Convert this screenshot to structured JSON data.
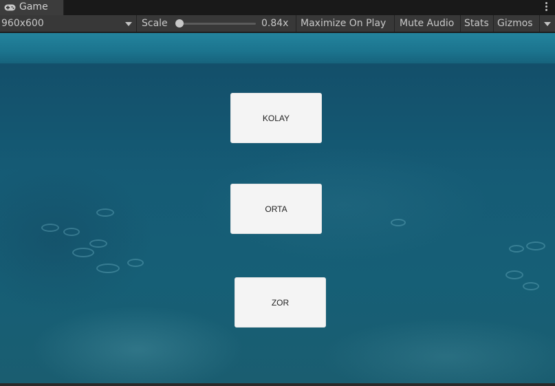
{
  "tab": {
    "label": "Game",
    "icon": "gamepad-icon"
  },
  "toolbar": {
    "resolution": "960x600",
    "scale_label": "Scale",
    "scale_value": "0.84x",
    "scale_level": 0.0,
    "maximize_on_play": "Maximize On Play",
    "mute_audio": "Mute Audio",
    "stats": "Stats",
    "gizmos": "Gizmos"
  },
  "game": {
    "buttons": [
      {
        "label": "KOLAY"
      },
      {
        "label": "ORTA"
      },
      {
        "label": "ZOR"
      }
    ]
  },
  "colors": {
    "editor_bg": "#191919",
    "toolbar_bg": "#383838",
    "water": "#155b75",
    "button_bg": "#f4f4f4"
  }
}
